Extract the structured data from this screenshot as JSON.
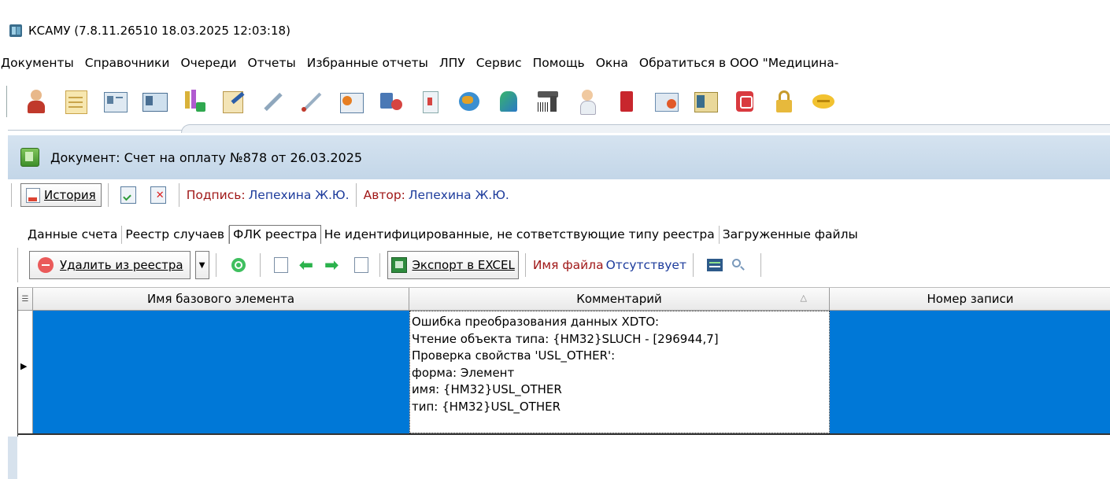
{
  "window": {
    "title": "КСАМУ (7.8.11.26510 18.03.2025 12:03:18)",
    "app_icon": "ksamu-app-icon"
  },
  "menu": {
    "items": [
      "Документы",
      "Справочники",
      "Очереди",
      "Отчеты",
      "Избранные отчеты",
      "ЛПУ",
      "Сервис",
      "Помощь",
      "Окна",
      "Обратиться в ООО \"Медицина-"
    ]
  },
  "main_toolbar": {
    "icons": [
      "doctor-icon",
      "notepad-icon",
      "card-icon",
      "id-card-icon",
      "lab-flask-icon",
      "journal-edit-icon",
      "syringe-icon",
      "thermometer-icon",
      "schedule-icon",
      "medicines-icon",
      "medical-book-icon",
      "globe-icon",
      "chemistry-icon",
      "barcode-scanner-icon",
      "nurse-icon",
      "red-book-icon",
      "calendar-icon",
      "report-icon",
      "pdf-icon",
      "lock-icon",
      "chat-icon"
    ]
  },
  "document": {
    "title": "Документ: Счет на оплату №878 от 26.03.2025",
    "toolbar": {
      "history_label": "История",
      "signature_label": "Подпись:",
      "signature_value": "Лепехина Ж.Ю.",
      "author_label": "Автор:",
      "author_value": "Лепехина Ж.Ю."
    },
    "tabs": [
      "Данные счета",
      "Реестр случаев",
      "ФЛК реестра",
      "Не идентифицированные, не сответствующие типу реестра",
      "Загруженные файлы"
    ],
    "active_tab": "ФЛК реестра"
  },
  "flk": {
    "toolbar": {
      "delete_label": "Удалить из реестра",
      "export_label": "Экспорт в EXCEL",
      "file_name_label": "Имя файла",
      "file_name_value": "Отсутствует"
    },
    "grid": {
      "columns": [
        "Имя базового элемента",
        "Комментарий",
        "Номер записи"
      ],
      "sorted_column": "Комментарий",
      "rows": [
        {
          "base_element": "",
          "comment": "Ошибка преобразования данных XDTO:\nЧтение объекта типа: {HM32}SLUCH - [296944,7]\nПроверка свойства 'USL_OTHER':\nформа: Элемент\nимя: {HM32}USL_OTHER\nтип: {HM32}USL_OTHER",
          "record_number": ""
        }
      ]
    }
  },
  "colors": {
    "selection": "#0078d7",
    "header_gradient_top": "#d5e3f0",
    "signature_red": "#a01818",
    "author_blue": "#1d3c9c"
  }
}
